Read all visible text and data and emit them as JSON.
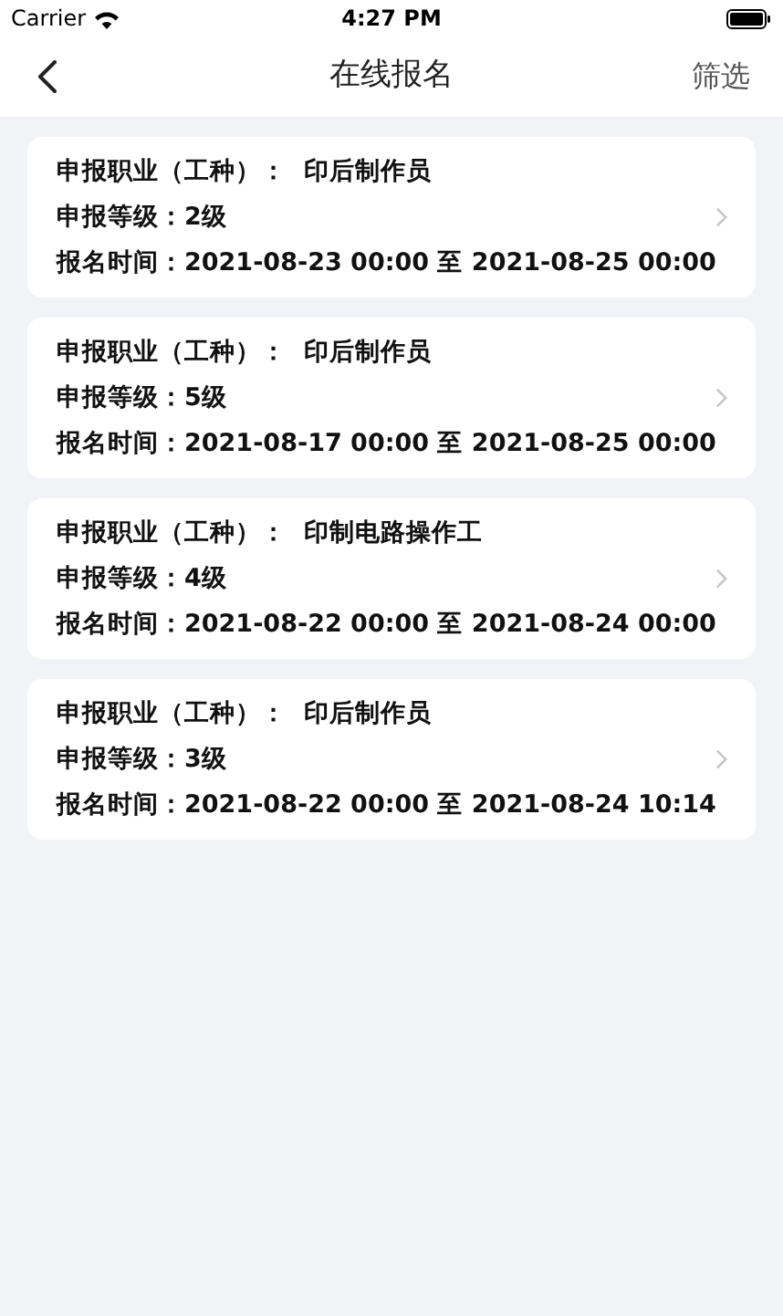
{
  "status_bar": {
    "carrier": "Carrier",
    "time": "4:27 PM"
  },
  "nav": {
    "title": "在线报名",
    "action": "筛选"
  },
  "records": [
    {
      "lines": [
        "申报职业（工种）：  印后制作员",
        "申报等级：2级",
        "报名时间：2021-08-23 00:00 至 2021-08-25 00:00"
      ]
    },
    {
      "lines": [
        "申报职业（工种）：  印后制作员",
        "申报等级：5级",
        "报名时间：2021-08-17 00:00 至 2021-08-25 00:00"
      ]
    },
    {
      "lines": [
        "申报职业（工种）：  印制电路操作工",
        "申报等级：4级",
        "报名时间：2021-08-22 00:00 至 2021-08-24 00:00"
      ]
    },
    {
      "lines": [
        "申报职业（工种）：  印后制作员",
        "申报等级：3级",
        "报名时间：2021-08-22 00:00 至 2021-08-24 10:14"
      ]
    }
  ]
}
